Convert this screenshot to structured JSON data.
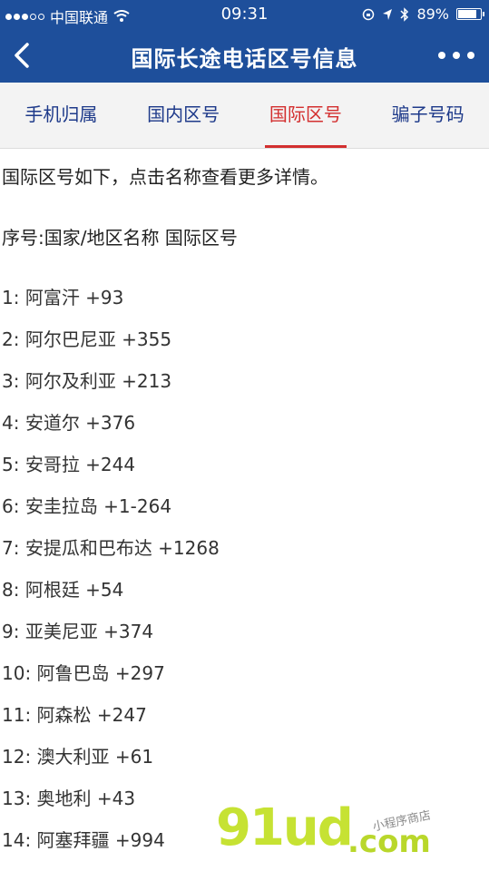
{
  "status_bar": {
    "carrier": "中国联通",
    "time": "09:31",
    "battery": "89%",
    "battery_level": 0.89
  },
  "navbar": {
    "title": "国际长途电话区号信息"
  },
  "tabs": [
    {
      "label": "手机归属",
      "active": false
    },
    {
      "label": "国内区号",
      "active": false
    },
    {
      "label": "国际区号",
      "active": true
    },
    {
      "label": "骗子号码",
      "active": false
    }
  ],
  "content": {
    "intro": "国际区号如下，点击名称查看更多详情。",
    "column_header": "序号:国家/地区名称 国际区号",
    "items": [
      "1: 阿富汗 +93",
      "2: 阿尔巴尼亚 +355",
      "3: 阿尔及利亚 +213",
      "4: 安道尔 +376",
      "5: 安哥拉 +244",
      "6: 安圭拉岛 +1-264",
      "7: 安提瓜和巴布达 +1268",
      "8: 阿根廷 +54",
      "9: 亚美尼亚 +374",
      "10: 阿鲁巴岛 +297",
      "11: 阿森松 +247",
      "12: 澳大利亚 +61",
      "13: 奥地利 +43",
      "14: 阿塞拜疆 +994"
    ]
  },
  "watermark": {
    "main": "91ud",
    "domain": ".com",
    "sub": "小程序商店"
  },
  "colors": {
    "header_bg": "#1e4f9b",
    "tab_text": "#1e3a8a",
    "tab_active": "#d32f2f",
    "tab_bar_bg": "#f3f3f3"
  }
}
